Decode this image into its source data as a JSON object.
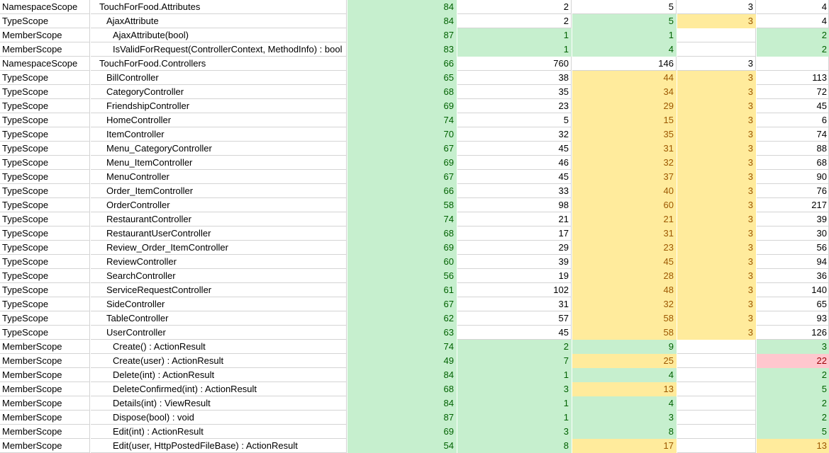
{
  "colors": {
    "good_fill": "#c6efce",
    "good_text": "#006100",
    "warn_fill": "#ffeb9c",
    "warn_text": "#9c5700",
    "bad_fill": "#ffc7ce",
    "bad_text": "#9c0006",
    "grid": "#d4d4d4"
  },
  "rows": [
    {
      "scope": "NamespaceScope",
      "name": "TouchForFood.Attributes",
      "indent": 0,
      "v": [
        [
          "84",
          "good"
        ],
        [
          "2",
          "plain"
        ],
        [
          "5",
          "plain"
        ],
        [
          "3",
          "plain"
        ],
        [
          "4",
          "plain"
        ]
      ]
    },
    {
      "scope": "TypeScope",
      "name": "AjaxAttribute",
      "indent": 1,
      "v": [
        [
          "84",
          "good"
        ],
        [
          "2",
          "plain"
        ],
        [
          "5",
          "good"
        ],
        [
          "3",
          "warn"
        ],
        [
          "4",
          "plain"
        ]
      ]
    },
    {
      "scope": "MemberScope",
      "name": "AjaxAttribute(bool)",
      "indent": 2,
      "v": [
        [
          "87",
          "good"
        ],
        [
          "1",
          "good"
        ],
        [
          "1",
          "good"
        ],
        [
          "",
          "plain"
        ],
        [
          "2",
          "good"
        ]
      ]
    },
    {
      "scope": "MemberScope",
      "name": "IsValidForRequest(ControllerContext, MethodInfo) : bool",
      "indent": 2,
      "v": [
        [
          "83",
          "good"
        ],
        [
          "1",
          "good"
        ],
        [
          "4",
          "good"
        ],
        [
          "",
          "plain"
        ],
        [
          "2",
          "good"
        ]
      ]
    },
    {
      "scope": "NamespaceScope",
      "name": "TouchForFood.Controllers",
      "indent": 0,
      "v": [
        [
          "66",
          "good"
        ],
        [
          "760",
          "plain"
        ],
        [
          "146",
          "plain"
        ],
        [
          "3",
          "plain"
        ],
        [
          "",
          "plain"
        ]
      ]
    },
    {
      "scope": "TypeScope",
      "name": "BillController",
      "indent": 1,
      "v": [
        [
          "65",
          "good"
        ],
        [
          "38",
          "plain"
        ],
        [
          "44",
          "warn"
        ],
        [
          "3",
          "warn"
        ],
        [
          "113",
          "plain"
        ]
      ]
    },
    {
      "scope": "TypeScope",
      "name": "CategoryController",
      "indent": 1,
      "v": [
        [
          "68",
          "good"
        ],
        [
          "35",
          "plain"
        ],
        [
          "34",
          "warn"
        ],
        [
          "3",
          "warn"
        ],
        [
          "72",
          "plain"
        ]
      ]
    },
    {
      "scope": "TypeScope",
      "name": "FriendshipController",
      "indent": 1,
      "v": [
        [
          "69",
          "good"
        ],
        [
          "23",
          "plain"
        ],
        [
          "29",
          "warn"
        ],
        [
          "3",
          "warn"
        ],
        [
          "45",
          "plain"
        ]
      ]
    },
    {
      "scope": "TypeScope",
      "name": "HomeController",
      "indent": 1,
      "v": [
        [
          "74",
          "good"
        ],
        [
          "5",
          "plain"
        ],
        [
          "15",
          "warn"
        ],
        [
          "3",
          "warn"
        ],
        [
          "6",
          "plain"
        ]
      ]
    },
    {
      "scope": "TypeScope",
      "name": "ItemController",
      "indent": 1,
      "v": [
        [
          "70",
          "good"
        ],
        [
          "32",
          "plain"
        ],
        [
          "35",
          "warn"
        ],
        [
          "3",
          "warn"
        ],
        [
          "74",
          "plain"
        ]
      ]
    },
    {
      "scope": "TypeScope",
      "name": "Menu_CategoryController",
      "indent": 1,
      "v": [
        [
          "67",
          "good"
        ],
        [
          "45",
          "plain"
        ],
        [
          "31",
          "warn"
        ],
        [
          "3",
          "warn"
        ],
        [
          "88",
          "plain"
        ]
      ]
    },
    {
      "scope": "TypeScope",
      "name": "Menu_ItemController",
      "indent": 1,
      "v": [
        [
          "69",
          "good"
        ],
        [
          "46",
          "plain"
        ],
        [
          "32",
          "warn"
        ],
        [
          "3",
          "warn"
        ],
        [
          "68",
          "plain"
        ]
      ]
    },
    {
      "scope": "TypeScope",
      "name": "MenuController",
      "indent": 1,
      "v": [
        [
          "67",
          "good"
        ],
        [
          "45",
          "plain"
        ],
        [
          "37",
          "warn"
        ],
        [
          "3",
          "warn"
        ],
        [
          "90",
          "plain"
        ]
      ]
    },
    {
      "scope": "TypeScope",
      "name": "Order_ItemController",
      "indent": 1,
      "v": [
        [
          "66",
          "good"
        ],
        [
          "33",
          "plain"
        ],
        [
          "40",
          "warn"
        ],
        [
          "3",
          "warn"
        ],
        [
          "76",
          "plain"
        ]
      ]
    },
    {
      "scope": "TypeScope",
      "name": "OrderController",
      "indent": 1,
      "v": [
        [
          "58",
          "good"
        ],
        [
          "98",
          "plain"
        ],
        [
          "60",
          "warn"
        ],
        [
          "3",
          "warn"
        ],
        [
          "217",
          "plain"
        ]
      ]
    },
    {
      "scope": "TypeScope",
      "name": "RestaurantController",
      "indent": 1,
      "v": [
        [
          "74",
          "good"
        ],
        [
          "21",
          "plain"
        ],
        [
          "21",
          "warn"
        ],
        [
          "3",
          "warn"
        ],
        [
          "39",
          "plain"
        ]
      ]
    },
    {
      "scope": "TypeScope",
      "name": "RestaurantUserController",
      "indent": 1,
      "v": [
        [
          "68",
          "good"
        ],
        [
          "17",
          "plain"
        ],
        [
          "31",
          "warn"
        ],
        [
          "3",
          "warn"
        ],
        [
          "30",
          "plain"
        ]
      ]
    },
    {
      "scope": "TypeScope",
      "name": "Review_Order_ItemController",
      "indent": 1,
      "v": [
        [
          "69",
          "good"
        ],
        [
          "29",
          "plain"
        ],
        [
          "23",
          "warn"
        ],
        [
          "3",
          "warn"
        ],
        [
          "56",
          "plain"
        ]
      ]
    },
    {
      "scope": "TypeScope",
      "name": "ReviewController",
      "indent": 1,
      "v": [
        [
          "60",
          "good"
        ],
        [
          "39",
          "plain"
        ],
        [
          "45",
          "warn"
        ],
        [
          "3",
          "warn"
        ],
        [
          "94",
          "plain"
        ]
      ]
    },
    {
      "scope": "TypeScope",
      "name": "SearchController",
      "indent": 1,
      "v": [
        [
          "56",
          "good"
        ],
        [
          "19",
          "plain"
        ],
        [
          "28",
          "warn"
        ],
        [
          "3",
          "warn"
        ],
        [
          "36",
          "plain"
        ]
      ]
    },
    {
      "scope": "TypeScope",
      "name": "ServiceRequestController",
      "indent": 1,
      "v": [
        [
          "61",
          "good"
        ],
        [
          "102",
          "plain"
        ],
        [
          "48",
          "warn"
        ],
        [
          "3",
          "warn"
        ],
        [
          "140",
          "plain"
        ]
      ]
    },
    {
      "scope": "TypeScope",
      "name": "SideController",
      "indent": 1,
      "v": [
        [
          "67",
          "good"
        ],
        [
          "31",
          "plain"
        ],
        [
          "32",
          "warn"
        ],
        [
          "3",
          "warn"
        ],
        [
          "65",
          "plain"
        ]
      ]
    },
    {
      "scope": "TypeScope",
      "name": "TableController",
      "indent": 1,
      "v": [
        [
          "62",
          "good"
        ],
        [
          "57",
          "plain"
        ],
        [
          "58",
          "warn"
        ],
        [
          "3",
          "warn"
        ],
        [
          "93",
          "plain"
        ]
      ]
    },
    {
      "scope": "TypeScope",
      "name": "UserController",
      "indent": 1,
      "v": [
        [
          "63",
          "good"
        ],
        [
          "45",
          "plain"
        ],
        [
          "58",
          "warn"
        ],
        [
          "3",
          "warn"
        ],
        [
          "126",
          "plain"
        ]
      ]
    },
    {
      "scope": "MemberScope",
      "name": "Create() : ActionResult",
      "indent": 2,
      "v": [
        [
          "74",
          "good"
        ],
        [
          "2",
          "good"
        ],
        [
          "9",
          "good"
        ],
        [
          "",
          "plain"
        ],
        [
          "3",
          "good"
        ]
      ]
    },
    {
      "scope": "MemberScope",
      "name": "Create(user) : ActionResult",
      "indent": 2,
      "v": [
        [
          "49",
          "good"
        ],
        [
          "7",
          "good"
        ],
        [
          "25",
          "warn"
        ],
        [
          "",
          "plain"
        ],
        [
          "22",
          "bad"
        ]
      ]
    },
    {
      "scope": "MemberScope",
      "name": "Delete(int) : ActionResult",
      "indent": 2,
      "v": [
        [
          "84",
          "good"
        ],
        [
          "1",
          "good"
        ],
        [
          "4",
          "good"
        ],
        [
          "",
          "plain"
        ],
        [
          "2",
          "good"
        ]
      ]
    },
    {
      "scope": "MemberScope",
      "name": "DeleteConfirmed(int) : ActionResult",
      "indent": 2,
      "v": [
        [
          "68",
          "good"
        ],
        [
          "3",
          "good"
        ],
        [
          "13",
          "warn"
        ],
        [
          "",
          "plain"
        ],
        [
          "5",
          "good"
        ]
      ]
    },
    {
      "scope": "MemberScope",
      "name": "Details(int) : ViewResult",
      "indent": 2,
      "v": [
        [
          "84",
          "good"
        ],
        [
          "1",
          "good"
        ],
        [
          "4",
          "good"
        ],
        [
          "",
          "plain"
        ],
        [
          "2",
          "good"
        ]
      ]
    },
    {
      "scope": "MemberScope",
      "name": "Dispose(bool) : void",
      "indent": 2,
      "v": [
        [
          "87",
          "good"
        ],
        [
          "1",
          "good"
        ],
        [
          "3",
          "good"
        ],
        [
          "",
          "plain"
        ],
        [
          "2",
          "good"
        ]
      ]
    },
    {
      "scope": "MemberScope",
      "name": "Edit(int) : ActionResult",
      "indent": 2,
      "v": [
        [
          "69",
          "good"
        ],
        [
          "3",
          "good"
        ],
        [
          "8",
          "good"
        ],
        [
          "",
          "plain"
        ],
        [
          "5",
          "good"
        ]
      ]
    },
    {
      "scope": "MemberScope",
      "name": "Edit(user, HttpPostedFileBase) : ActionResult",
      "indent": 2,
      "v": [
        [
          "54",
          "good"
        ],
        [
          "8",
          "good"
        ],
        [
          "17",
          "warn"
        ],
        [
          "",
          "plain"
        ],
        [
          "13",
          "warn"
        ]
      ]
    }
  ]
}
